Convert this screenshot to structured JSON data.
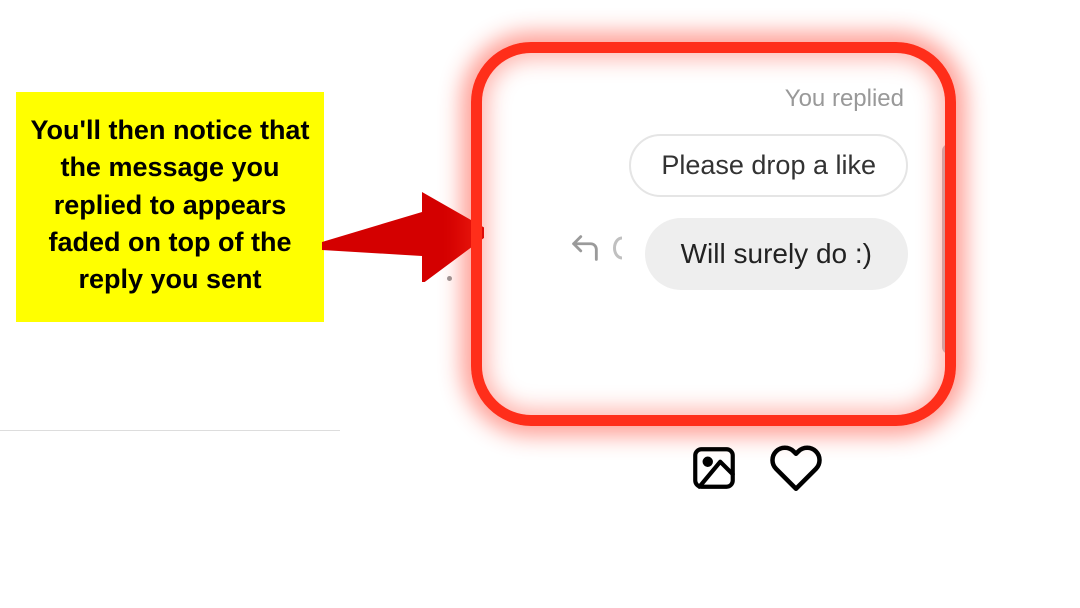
{
  "callout": {
    "text": "You'll then notice that the message you replied to appears faded on top of the reply you sent"
  },
  "chat": {
    "replied_label": "You replied",
    "quoted_message": "Please drop a like",
    "reply_message": "Will surely do :)"
  }
}
